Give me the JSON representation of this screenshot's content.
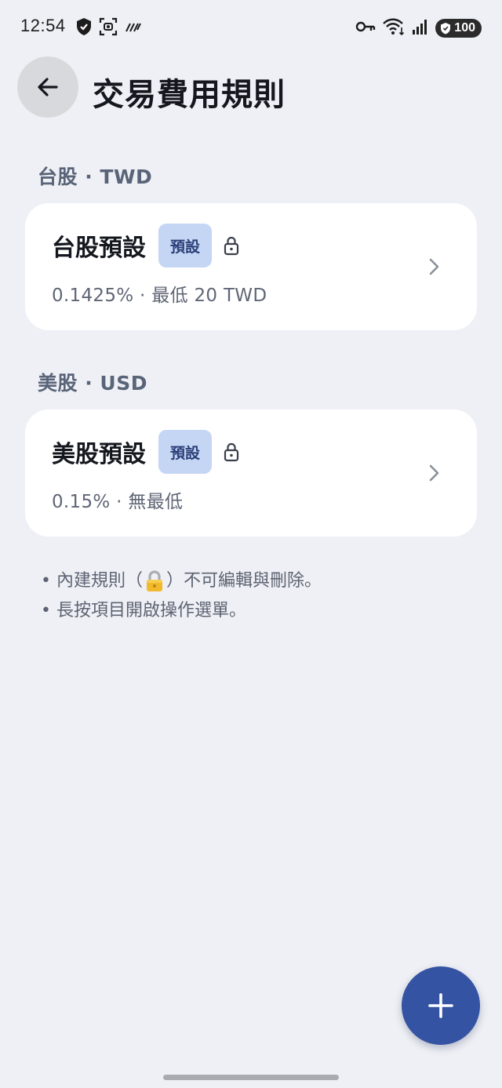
{
  "status": {
    "time": "12:54",
    "battery": "100"
  },
  "header": {
    "title": "交易費用規則"
  },
  "sections": [
    {
      "label": "台股 · TWD",
      "rule": {
        "name": "台股預設",
        "badge": "預設",
        "detail": "0.1425% · 最低 20 TWD"
      }
    },
    {
      "label": "美股 · USD",
      "rule": {
        "name": "美股預設",
        "badge": "預設",
        "detail": "0.15% · 無最低"
      }
    }
  ],
  "notes": {
    "bullet": "•",
    "line1_before": "內建規則（",
    "line1_after": "）不可編輯與刪除。",
    "line2": "長按項目開啟操作選單。"
  },
  "colors": {
    "background": "#eef0f5",
    "badge_bg": "#c5d6f4",
    "badge_text": "#2a3f78",
    "fab": "#3553a3"
  },
  "icons": {
    "back": "arrow-left-icon",
    "lock": "lock-icon",
    "chevron": "chevron-right-icon",
    "fab": "plus-icon"
  }
}
